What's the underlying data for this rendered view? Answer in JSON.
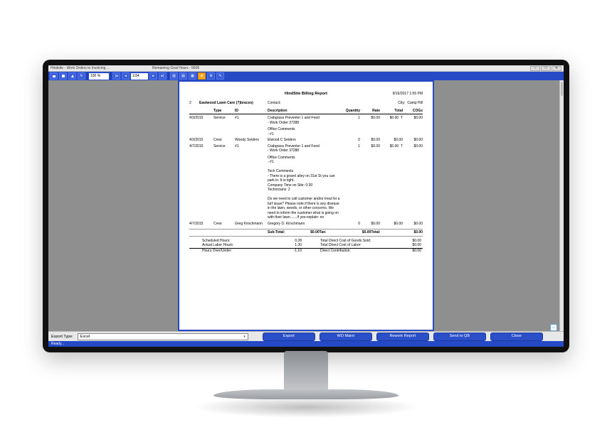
{
  "window": {
    "title": "Hindsite - Work Orders to Invoicing ...",
    "goal": "Remaining Goal Hours - 5605",
    "win_buttons": [
      "–",
      "□",
      "✕"
    ]
  },
  "toolbar": {
    "zoom": "100 %",
    "page": "1/34"
  },
  "report": {
    "title": "HindSite Billing Report",
    "print_date": "8/16/2017 1:55 PM",
    "cust_num": "2",
    "customer": "Eastwood Lawn Care (?)braces)",
    "contact_label": "Contact:",
    "city_label": "City:",
    "city": "Camp Hill",
    "columns": {
      "date": "",
      "type": "Type",
      "id": "ID",
      "desc": "Description",
      "qty": "Quantity",
      "rate": "Rate",
      "total": "Total",
      "cogs": "COGs"
    },
    "rows": [
      {
        "date": "4/3/2015",
        "type": "Service",
        "id": "#1",
        "desc": "Crabgrass Preventer 1 and Feed",
        "desc2": "- Work Order 37288",
        "extra": "Office Comments\n- #1",
        "qty": "1",
        "rate": "$0.00",
        "total": "$0.00",
        "flag": "T",
        "cogs": "$0.00"
      },
      {
        "date": "4/3/2015",
        "type": "Crew",
        "id": "Woody Seiders",
        "desc": "Elwood C Seiders",
        "qty": "0",
        "rate": "$0.00",
        "total": "$0.00",
        "flag": "",
        "cogs": "$0.00"
      },
      {
        "date": "4/7/2015",
        "type": "Service",
        "id": "#1",
        "desc": "Crabgrass Preventer 1 and Feed",
        "desc2": "- Work Order 37288",
        "extra": "Office Comments\n- #1\n\nTech Comments\n- There is a gravel alley on 31st St you can park in. It is tight.\nCompany Time on Site: 0:39\nTechnicians: 2\n\nDo we need to call customer and/or treat for a turf issue? Please note if there is any disease in the lawn, weeds, or other concerns. We need to inform the customer what is going on with their lawn.......If yes-explain: no",
        "qty": "1",
        "rate": "$0.00",
        "total": "$0.00",
        "flag": "T",
        "cogs": "$0.00"
      },
      {
        "date": "4/7/2015",
        "type": "Crew",
        "id": "Greg Kirschmann",
        "desc": "Gregory D. Kirschmann",
        "qty": "0",
        "rate": "$0.00",
        "total": "$0.00",
        "flag": "",
        "cogs": "$0.00"
      }
    ],
    "subtotal": {
      "label_sub": "Sub-Total:",
      "val_sub": "$0.00",
      "label_tax": "Tax:",
      "val_tax": "$0.00",
      "label_total": "Total:",
      "val_total": "$0.00"
    },
    "summary": {
      "sched_label": "Scheduled Hours:",
      "sched": "0.28",
      "actual_label": "Actual Labor Hours:",
      "actual": "1.30",
      "over_label": "Hours Over/Under:",
      "over": "-1.10",
      "cogs_label": "Total Direct Cost of Goods Sold:",
      "cogs": "$0.00",
      "labor_label": "Total Direct Cost of Labor:",
      "labor": "$0.00",
      "contrib_label": "Direct Contribution:",
      "contrib": "$0.00"
    }
  },
  "footer": {
    "export_type_label": "Export Type:",
    "export_type_value": "Excel",
    "buttons": {
      "export": "Export",
      "wo_maint": "WO Maint",
      "rework": "Rework Report",
      "send_qb": "Send to QB",
      "close": "Close"
    }
  },
  "status": "Ready..."
}
